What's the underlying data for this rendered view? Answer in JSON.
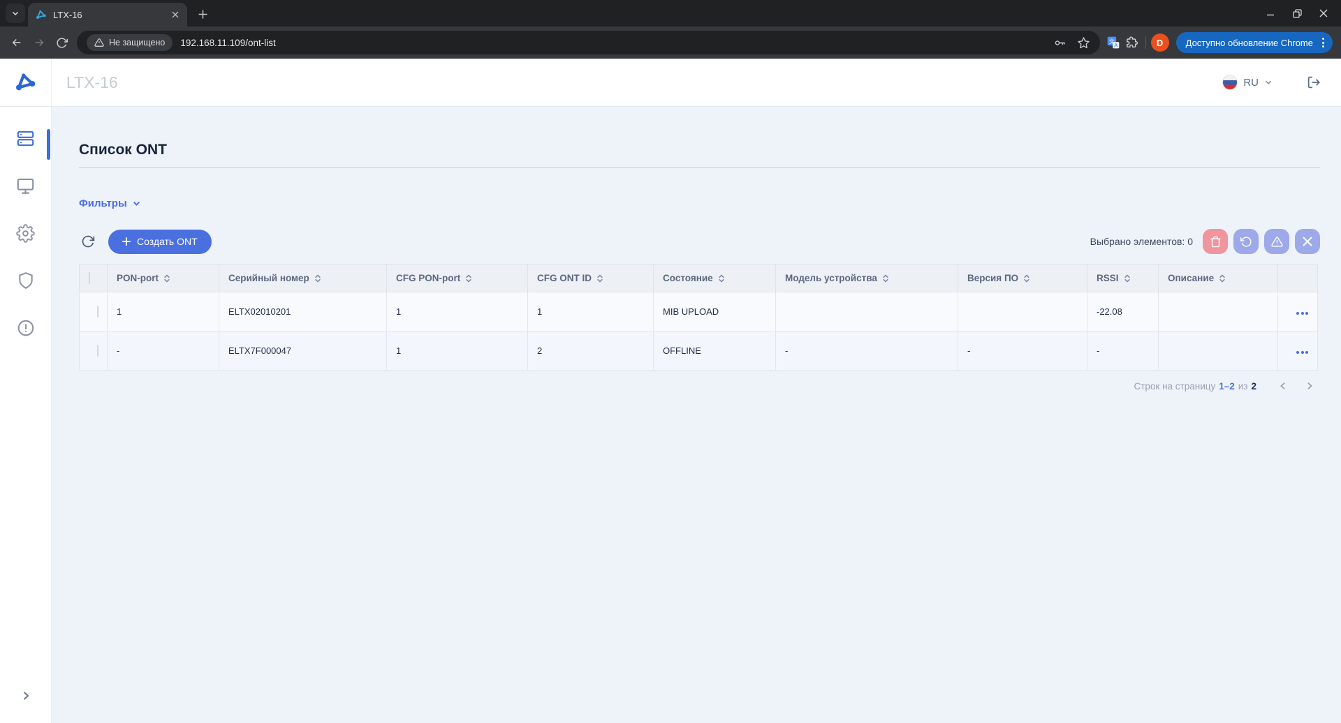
{
  "browser": {
    "tab_title": "LTX-16",
    "security_chip": "Не защищено",
    "url": "192.168.11.109/ont-list",
    "avatar_letter": "D",
    "update_button": "Доступно обновление Chrome"
  },
  "header": {
    "brand": "LTX-16",
    "language": "RU"
  },
  "sidebar": {
    "items": [
      "ont-list",
      "devices",
      "settings",
      "security",
      "alerts"
    ]
  },
  "page": {
    "title": "Список ONT",
    "filters_label": "Фильтры",
    "create_button": "Создать ONT",
    "selected_label": "Выбрано элементов: 0"
  },
  "table": {
    "columns": [
      "PON-port",
      "Серийный номер",
      "CFG PON-port",
      "CFG ONT ID",
      "Состояние",
      "Модель устройства",
      "Версия ПО",
      "RSSI",
      "Описание"
    ],
    "rows": [
      {
        "pon_port": "1",
        "serial": "ELTX02010201",
        "cfg_pon_port": "1",
        "cfg_ont_id": "1",
        "state": "MIB UPLOAD",
        "model": "",
        "firmware": "",
        "rssi": "-22.08",
        "description": ""
      },
      {
        "pon_port": "-",
        "serial": "ELTX7F000047",
        "cfg_pon_port": "1",
        "cfg_ont_id": "2",
        "state": "OFFLINE",
        "model": "-",
        "firmware": "-",
        "rssi": "-",
        "description": ""
      }
    ]
  },
  "pagination": {
    "prefix": "Строк на страницу",
    "range": "1–2",
    "of_label": "из",
    "total": "2"
  },
  "colors": {
    "primary": "#4a6fdf",
    "sidebar_active": "#3b6ee0",
    "danger_button": "#f0949e",
    "muted_button": "#9da9e8",
    "content_bg": "#eef2f9",
    "update_pill": "#1767c0",
    "avatar": "#e8511f",
    "favicon": "#35a3da",
    "logo": "#2f64d6"
  }
}
